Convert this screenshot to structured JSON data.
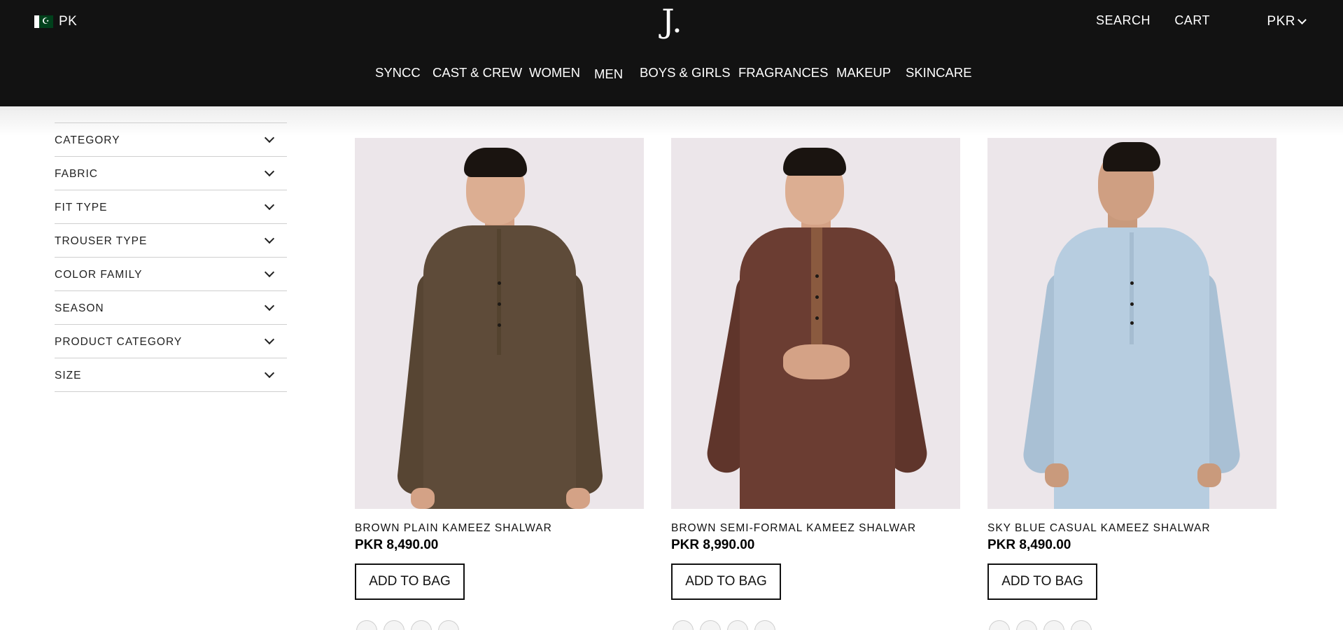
{
  "header": {
    "country_code": "PK",
    "logo_text": "J.",
    "search_label": "SEARCH",
    "cart_label": "CART",
    "currency_label": "PKR",
    "nav": [
      "SYNCC",
      "CAST & CREW",
      "WOMEN",
      "MEN",
      "BOYS & GIRLS",
      "FRAGRANCES",
      "MAKEUP",
      "SKINCARE"
    ]
  },
  "filters": [
    "CATEGORY",
    "FABRIC",
    "FIT TYPE",
    "TROUSER TYPE",
    "COLOR FAMILY",
    "SEASON",
    "PRODUCT CATEGORY",
    "SIZE"
  ],
  "products": [
    {
      "name": "BROWN PLAIN KAMEEZ SHALWAR",
      "price": "PKR 8,490.00",
      "button": "ADD TO BAG",
      "color": "#5e4b39"
    },
    {
      "name": "BROWN SEMI-FORMAL KAMEEZ SHALWAR",
      "price": "PKR 8,990.00",
      "button": "ADD TO BAG",
      "color": "#6b3d32"
    },
    {
      "name": "SKY BLUE CASUAL KAMEEZ SHALWAR",
      "price": "PKR 8,490.00",
      "button": "ADD TO BAG",
      "color": "#b7cde0"
    }
  ],
  "colors": {
    "header_bg": "#121212",
    "image_bg": "#ece6ea",
    "skin": "#d9a98c"
  }
}
